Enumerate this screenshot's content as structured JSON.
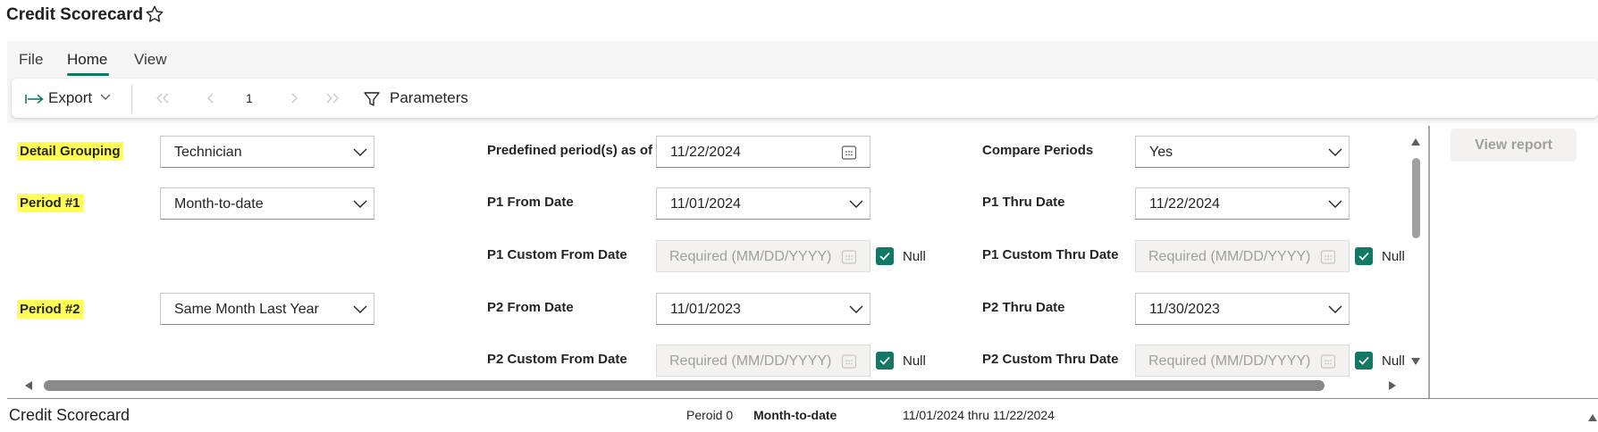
{
  "app": {
    "title": "Credit Scorecard"
  },
  "menu": {
    "file": "File",
    "home": "Home",
    "view": "View"
  },
  "toolbar": {
    "export_label": "Export",
    "page_number": "1",
    "parameters_label": "Parameters"
  },
  "parameters": {
    "detail_grouping": {
      "label": "Detail Grouping",
      "value": "Technician"
    },
    "period1": {
      "label": "Period #1",
      "value": "Month-to-date"
    },
    "period2": {
      "label": "Period #2",
      "value": "Same Month Last Year"
    },
    "predefined_as_of": {
      "label": "Predefined period(s) as of",
      "value": "11/22/2024"
    },
    "p1_from": {
      "label": "P1 From Date",
      "value": "11/01/2024"
    },
    "p1_custom_from": {
      "label": "P1 Custom From Date",
      "placeholder": "Required (MM/DD/YYYY)",
      "null_label": "Null",
      "null_checked": true
    },
    "p2_from": {
      "label": "P2 From Date",
      "value": "11/01/2023"
    },
    "p2_custom_from": {
      "label": "P2 Custom From Date",
      "placeholder": "Required (MM/DD/YYYY)",
      "null_label": "Null",
      "null_checked": true
    },
    "compare_periods": {
      "label": "Compare Periods",
      "value": "Yes"
    },
    "p1_thru": {
      "label": "P1 Thru Date",
      "value": "11/22/2024"
    },
    "p1_custom_thru": {
      "label": "P1 Custom Thru Date",
      "placeholder": "Required (MM/DD/YYYY)",
      "null_label": "Null",
      "null_checked": true
    },
    "p2_thru": {
      "label": "P2 Thru Date",
      "value": "11/30/2023"
    },
    "p2_custom_thru": {
      "label": "P2 Custom Thru Date",
      "placeholder": "Required (MM/DD/YYYY)",
      "null_label": "Null",
      "null_checked": true
    }
  },
  "view_report_label": "View report",
  "footer": {
    "report_title": "Credit Scorecard",
    "period_label": "Peroid 0",
    "period_value": "Month-to-date",
    "date_range": "11/01/2024 thru 11/22/2024"
  },
  "colors": {
    "accent": "#117865",
    "highlight": "#ffff55",
    "disabled_bg": "#f3f2f1"
  },
  "icons": [
    "star-icon",
    "export-icon",
    "chevron-down-icon",
    "first-page-icon",
    "previous-page-icon",
    "next-page-icon",
    "last-page-icon",
    "filter-icon",
    "calendar-icon",
    "checkmark-icon"
  ]
}
